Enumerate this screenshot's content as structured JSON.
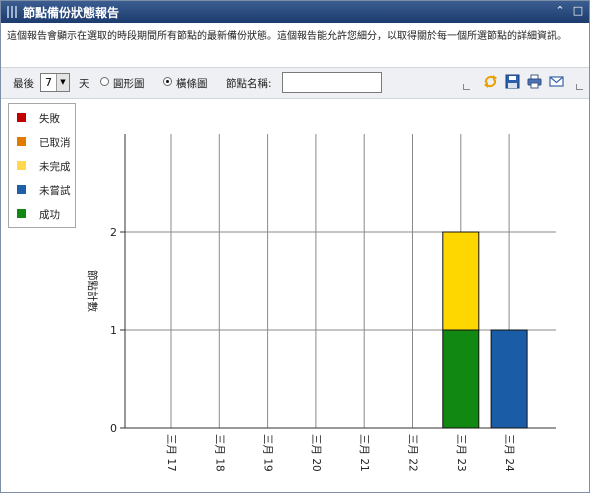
{
  "header": {
    "title": "節點備份狀態報告",
    "collapse_icon": "⌃",
    "maximize_icon": "□"
  },
  "description": "這個報告會顯示在選取的時段期間所有節點的最新備份狀態。這個報告能允許您細分，以取得關於每一個所選節點的詳細資訊。",
  "toolbar": {
    "last_label": "最後",
    "days_value": "7",
    "days_unit": "天",
    "pie_label": "圓形圖",
    "bar_label": "橫條圖",
    "node_label": "節點名稱:",
    "node_value": "",
    "selected_view": "bar",
    "icons": [
      "refresh-icon",
      "save-icon",
      "print-icon",
      "email-icon"
    ]
  },
  "legend": {
    "items": [
      {
        "label": "失敗",
        "color": "#c00000"
      },
      {
        "label": "已取消",
        "color": "#e07b00"
      },
      {
        "label": "未完成",
        "color": "#ffd84d"
      },
      {
        "label": "未嘗試",
        "color": "#1f5fa8"
      },
      {
        "label": "成功",
        "color": "#118811"
      }
    ]
  },
  "chart_data": {
    "type": "bar",
    "stacked": true,
    "ylabel": "節點計數",
    "ylim": [
      0,
      3
    ],
    "yticks": [
      0,
      1,
      2
    ],
    "grid": true,
    "legend": "top-left",
    "categories": [
      "三月 17",
      "三月 18",
      "三月 19",
      "三月 20",
      "三月 21",
      "三月 22",
      "三月 23",
      "三月 24"
    ],
    "series": [
      {
        "name": "成功",
        "color": "#118811",
        "values": [
          0,
          0,
          0,
          0,
          0,
          0,
          1,
          0
        ]
      },
      {
        "name": "未嘗試",
        "color": "#1a5da6",
        "values": [
          0,
          0,
          0,
          0,
          0,
          0,
          0,
          1
        ]
      },
      {
        "name": "未完成",
        "color": "#ffd700",
        "values": [
          0,
          0,
          0,
          0,
          0,
          0,
          1,
          0
        ]
      },
      {
        "name": "已取消",
        "color": "#e07b00",
        "values": [
          0,
          0,
          0,
          0,
          0,
          0,
          0,
          0
        ]
      },
      {
        "name": "失敗",
        "color": "#c00000",
        "values": [
          0,
          0,
          0,
          0,
          0,
          0,
          0,
          0
        ]
      }
    ]
  }
}
